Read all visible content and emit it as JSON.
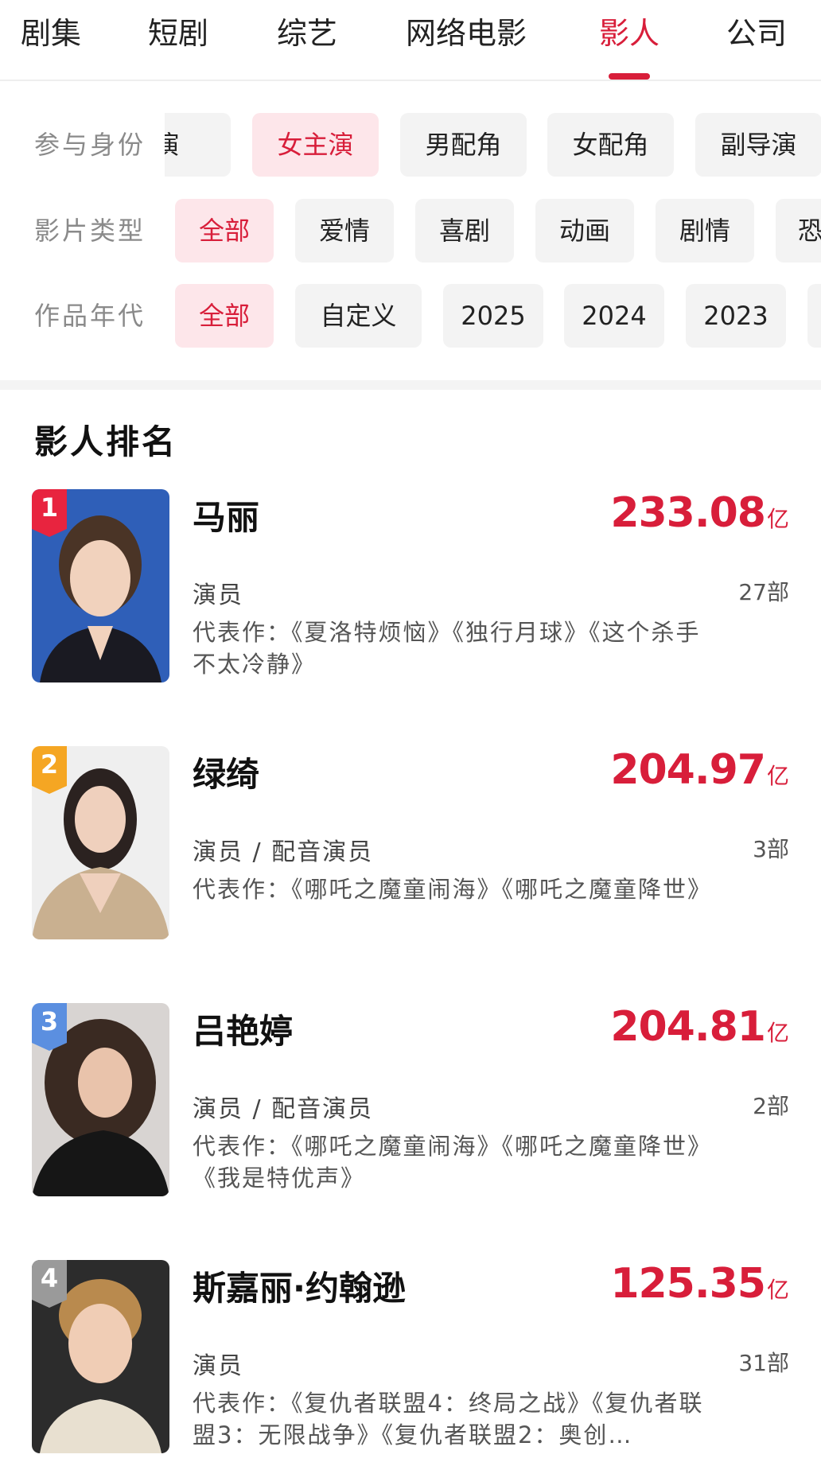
{
  "tabs": [
    {
      "label": "剧集",
      "active": false
    },
    {
      "label": "短剧",
      "active": false
    },
    {
      "label": "综艺",
      "active": false
    },
    {
      "label": "网络电影",
      "active": false
    },
    {
      "label": "影人",
      "active": true
    },
    {
      "label": "公司",
      "active": false
    }
  ],
  "filters": {
    "role": {
      "label": "参与身份",
      "options": [
        "主演",
        "女主演",
        "男配角",
        "女配角",
        "副导演"
      ],
      "selected": "女主演"
    },
    "genre": {
      "label": "影片类型",
      "options": [
        "全部",
        "爱情",
        "喜剧",
        "动画",
        "剧情",
        "恐"
      ],
      "selected": "全部"
    },
    "year": {
      "label": "作品年代",
      "options": [
        "全部",
        "自定义",
        "2025",
        "2024",
        "2023"
      ],
      "selected": "全部"
    }
  },
  "ranking": {
    "title": "影人排名",
    "unit": "亿",
    "items": [
      {
        "rank": "1",
        "name": "马丽",
        "box_office": "233.08",
        "role": "演员",
        "count": "27部",
        "works": "代表作：《夏洛特烦恼》《独行月球》《这个杀手不太冷静》",
        "badge_color": "#e8243f"
      },
      {
        "rank": "2",
        "name": "绿绮",
        "box_office": "204.97",
        "role": "演员 / 配音演员",
        "count": "3部",
        "works": "代表作：《哪吒之魔童闹海》《哪吒之魔童降世》",
        "badge_color": "#f5a623"
      },
      {
        "rank": "3",
        "name": "吕艳婷",
        "box_office": "204.81",
        "role": "演员 / 配音演员",
        "count": "2部",
        "works": "代表作：《哪吒之魔童闹海》《哪吒之魔童降世》《我是特优声》",
        "badge_color": "#5b8fe0"
      },
      {
        "rank": "4",
        "name": "斯嘉丽·约翰逊",
        "box_office": "125.35",
        "role": "演员",
        "count": "31部",
        "works": "代表作：《复仇者联盟4：终局之战》《复仇者联盟3：无限战争》《复仇者联盟2：奥创…",
        "badge_color": "#9a9a9a"
      }
    ]
  }
}
